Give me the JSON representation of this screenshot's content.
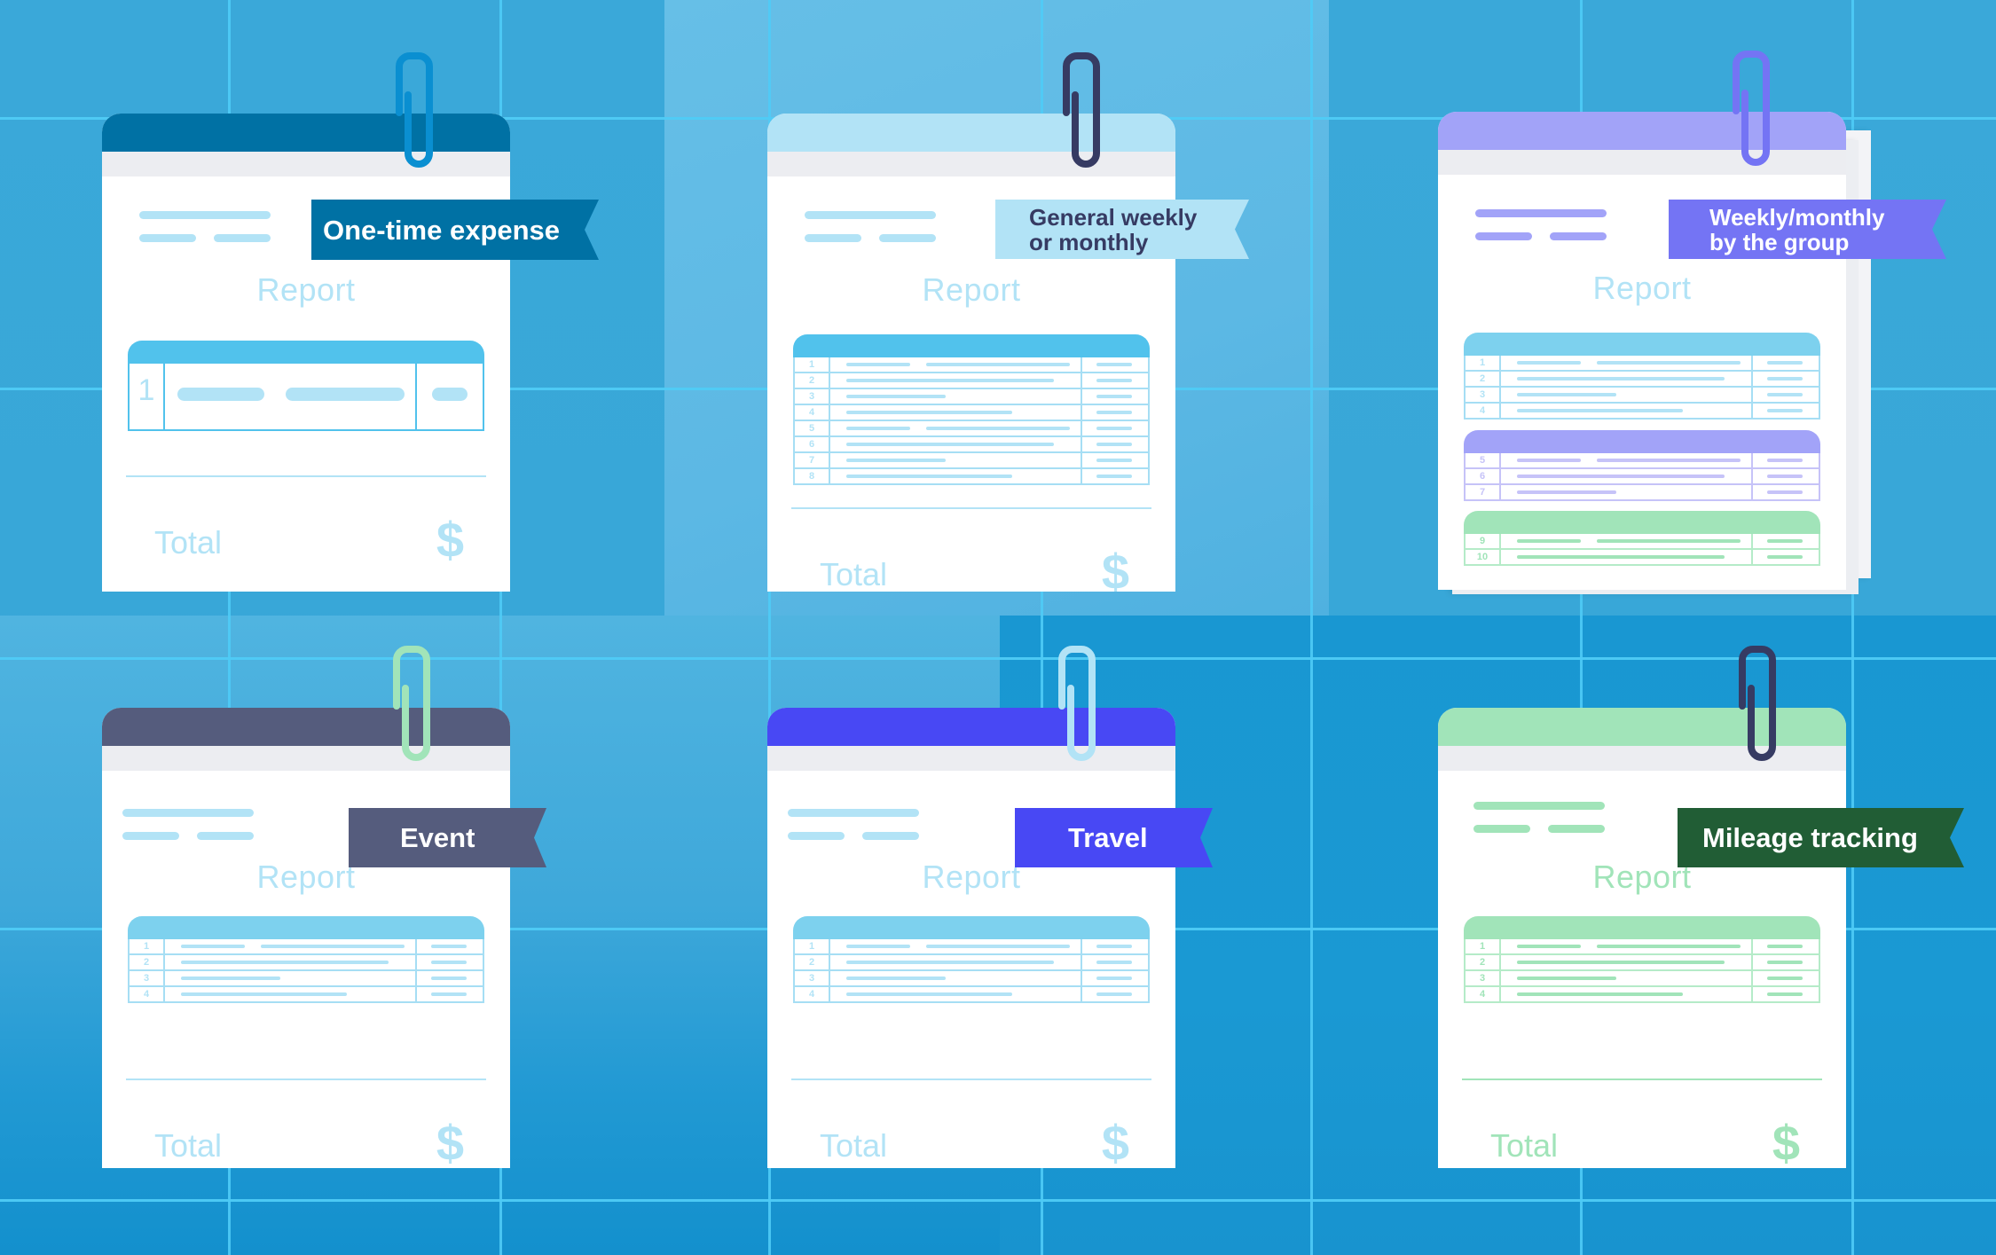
{
  "cards": [
    {
      "label": "One-time expense",
      "report_title": "Report",
      "total_label": "Total",
      "currency_symbol": "$",
      "rows": [
        "1"
      ],
      "colors": {
        "header": "#0071a4",
        "banner": "#0071a4",
        "banner_text": "#ffffff",
        "clip": "#0a8fd1",
        "accent": "#b2e3f6",
        "table_head": "#51c2ec",
        "table_border": "#51c2ec"
      }
    },
    {
      "label_line1": "General weekly",
      "label_line2": "or monthly",
      "report_title": "Report",
      "total_label": "Total",
      "currency_symbol": "$",
      "rows": [
        "1",
        "2",
        "3",
        "4",
        "5",
        "6",
        "7",
        "8"
      ],
      "colors": {
        "header": "#b2e3f6",
        "banner": "#b2e3f6",
        "banner_text": "#363b63",
        "clip": "#363b63",
        "accent": "#b2e3f6",
        "table_head": "#51c2ec",
        "table_border": "#a6def4"
      }
    },
    {
      "label_line1": "Weekly/monthly",
      "label_line2": "by the group",
      "report_title": "Report",
      "groups": [
        {
          "rows": [
            "1",
            "2",
            "3",
            "4"
          ],
          "head": "#7dd1ee",
          "line": "#b2e3f6",
          "border": "#a6def4"
        },
        {
          "rows": [
            "5",
            "6",
            "7"
          ],
          "head": "#a2a3f8",
          "line": "#c6c3f8",
          "border": "#c6c3f8"
        },
        {
          "rows": [
            "9",
            "10"
          ],
          "head": "#a1e4b9",
          "line": "#a1e4b9",
          "border": "#b5ebc8"
        }
      ],
      "colors": {
        "header": "#a2a3f8",
        "banner": "#7474f4",
        "banner_text": "#ffffff",
        "clip": "#7474f4",
        "accent": "#a2a3f8",
        "report": "#b2e3f6"
      }
    },
    {
      "label": "Event",
      "report_title": "Report",
      "total_label": "Total",
      "currency_symbol": "$",
      "rows": [
        "1",
        "2",
        "3",
        "4"
      ],
      "colors": {
        "header": "#555c7d",
        "banner": "#555c7d",
        "banner_text": "#ffffff",
        "clip": "#a1e4b9",
        "accent": "#b2e3f6",
        "table_head": "#7dd1ee",
        "table_border": "#a6def4"
      }
    },
    {
      "label": "Travel",
      "report_title": "Report",
      "total_label": "Total",
      "currency_symbol": "$",
      "rows": [
        "1",
        "2",
        "3",
        "4"
      ],
      "colors": {
        "header": "#4848f4",
        "banner": "#4848f4",
        "banner_text": "#ffffff",
        "clip": "#b2e3f6",
        "accent": "#b2e3f6",
        "table_head": "#7dd1ee",
        "table_border": "#a6def4"
      }
    },
    {
      "label": "Mileage tracking",
      "report_title": "Report",
      "total_label": "Total",
      "currency_symbol": "$",
      "rows": [
        "1",
        "2",
        "3",
        "4"
      ],
      "colors": {
        "header": "#a1e4b9",
        "banner": "#215d35",
        "banner_text": "#ffffff",
        "clip": "#363b63",
        "accent": "#a1e4b9",
        "table_head": "#a1e4b9",
        "table_border": "#b5ebc8"
      }
    }
  ]
}
